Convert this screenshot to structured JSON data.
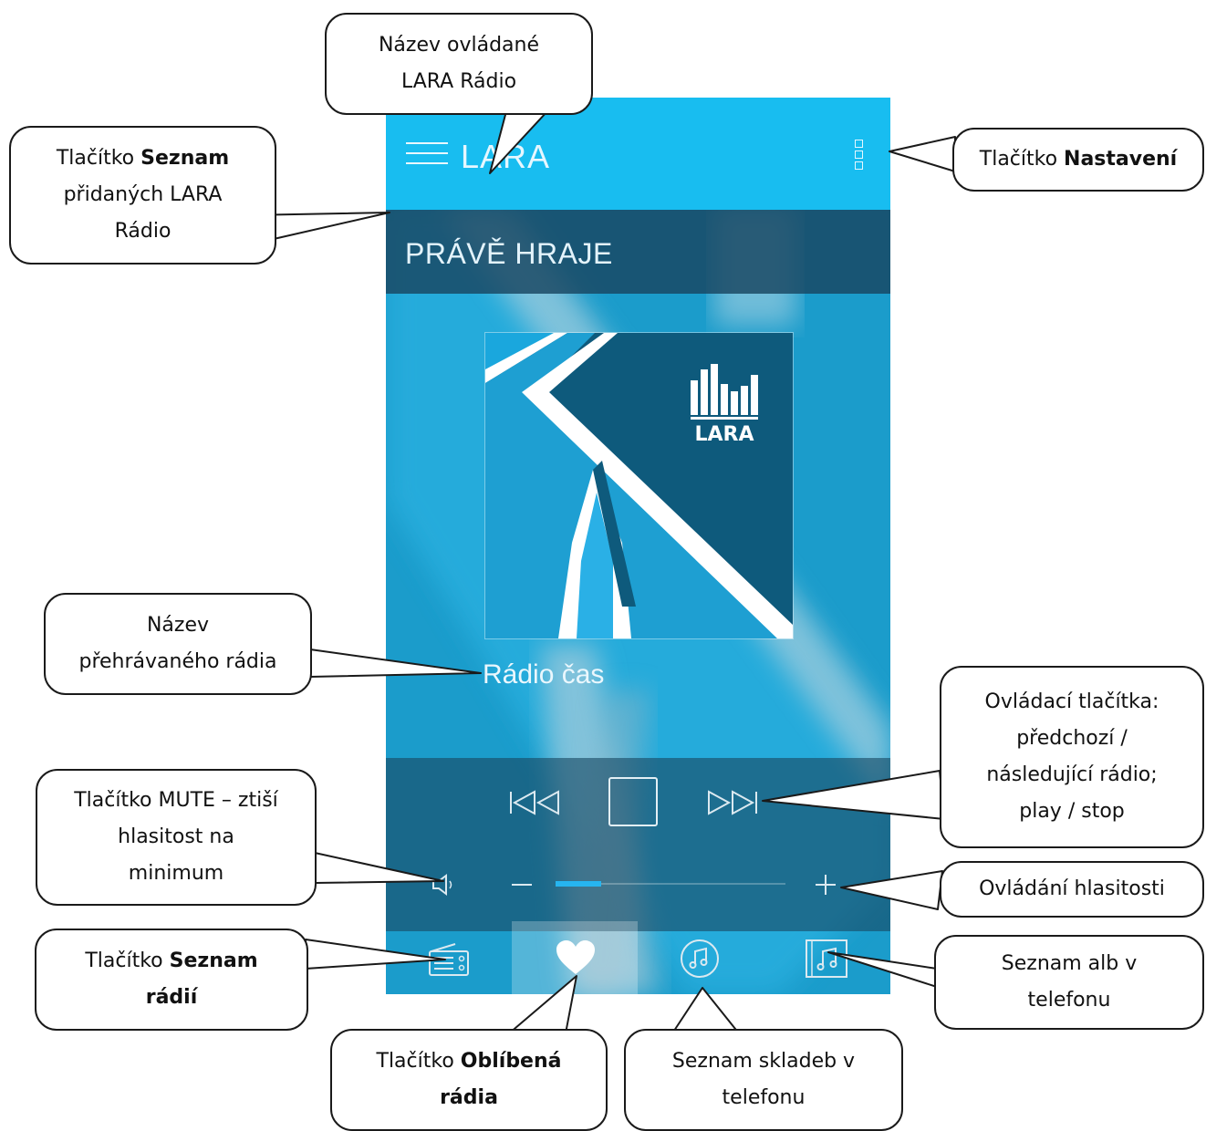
{
  "app": {
    "title": "LARA",
    "now_playing_label": "PRÁVĚ HRAJE",
    "radio_name": "Rádio čas",
    "album_logo_text": "LARA",
    "volume_level_percent": 20
  },
  "callouts": {
    "station_name": {
      "line1": "Název ovládané",
      "line2": "LARA Rádio"
    },
    "list_button": {
      "prefix": "Tlačítko ",
      "bold": "Seznam",
      "line2": "přidaných LARA",
      "line3": "Rádio"
    },
    "settings_button": {
      "prefix": "Tlačítko ",
      "bold": "Nastavení"
    },
    "playing_name": {
      "line1": "Název",
      "line2": "přehrávaného rádia"
    },
    "controls": {
      "line1": "Ovládací tlačítka:",
      "line2": "předchozí /",
      "line3": "následující rádio;",
      "line4": "play / stop"
    },
    "mute": {
      "line1": "Tlačítko MUTE – ztiší",
      "line2": "hlasitost na",
      "line3": "minimum"
    },
    "volume": {
      "line1": "Ovládání hlasitosti"
    },
    "radio_list": {
      "prefix": "Tlačítko ",
      "bold1": "Seznam",
      "bold2": "rádií"
    },
    "albums": {
      "line1": "Seznam alb v",
      "line2": "telefonu"
    },
    "favorites": {
      "prefix": "Tlačítko ",
      "bold1": "Oblíbená",
      "bold2": "rádia"
    },
    "tracks": {
      "line1": "Seznam skladeb v",
      "line2": "telefonu"
    }
  },
  "colors": {
    "topbar": "#18bdf0",
    "background": "#1b9ccb",
    "band": "#194660",
    "accent": "#26b5f0"
  }
}
